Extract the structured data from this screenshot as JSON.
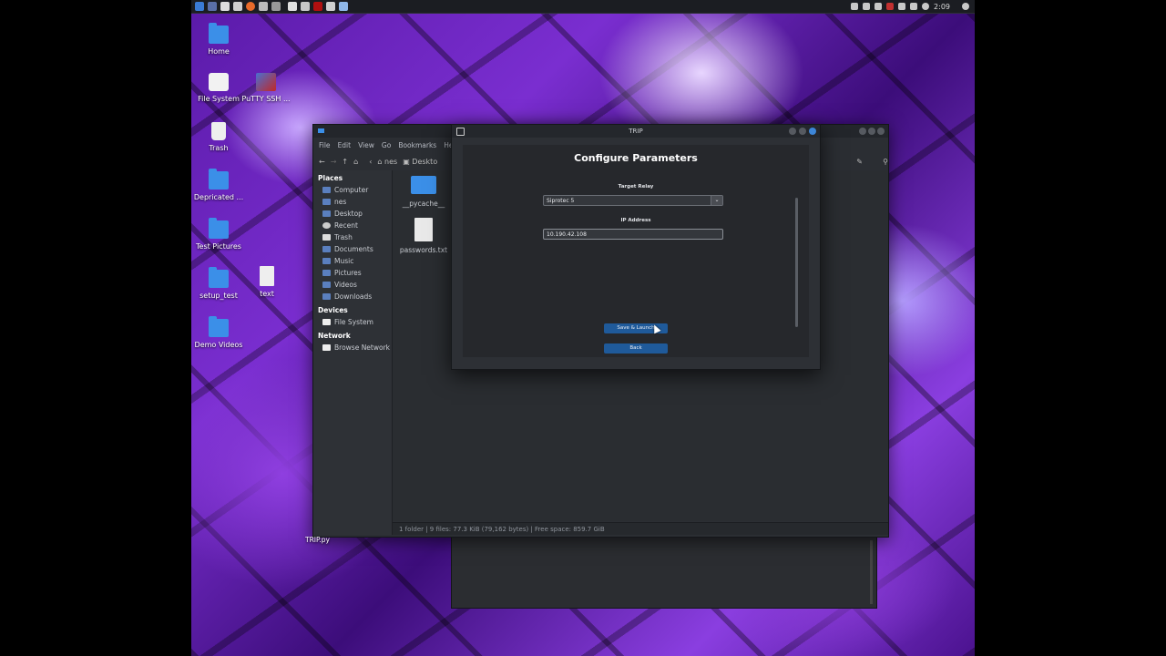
{
  "panel": {
    "clock": "2:09"
  },
  "desktop": {
    "icons": [
      {
        "label": "Home"
      },
      {
        "label": "File System"
      },
      {
        "label": "PuTTY SSH ..."
      },
      {
        "label": "Trash"
      },
      {
        "label": "Depricated ..."
      },
      {
        "label": "Test Pictures"
      },
      {
        "label": "setup_test"
      },
      {
        "label": "text"
      },
      {
        "label": "Demo Videos"
      }
    ],
    "trip_label": "TRIP.py"
  },
  "file_manager": {
    "menu": [
      "File",
      "Edit",
      "View",
      "Go",
      "Bookmarks",
      "Help"
    ],
    "path": [
      "nes",
      "Deskto"
    ],
    "sidebar": {
      "places_heading": "Places",
      "places": [
        "Computer",
        "nes",
        "Desktop",
        "Recent",
        "Trash",
        "Documents",
        "Music",
        "Pictures",
        "Videos",
        "Downloads"
      ],
      "devices_heading": "Devices",
      "devices": [
        "File System"
      ],
      "network_heading": "Network",
      "network": [
        "Browse Network"
      ]
    },
    "files": [
      {
        "name": "__pycache__",
        "type": "folder"
      },
      {
        "name": "passwords.txt",
        "type": "file"
      }
    ],
    "status": "1 folder | 9 files: 77.3 KiB (79,162 bytes) | Free space: 859.7 GiB"
  },
  "trip_dialog": {
    "title": "TRIP",
    "heading": "Configure Parameters",
    "relay_label": "Target Relay",
    "relay_value": "Siprotec 5",
    "ip_label": "IP Address",
    "ip_value": "10.190.42.108",
    "save_launch": "Save & Launch",
    "back": "Back"
  }
}
